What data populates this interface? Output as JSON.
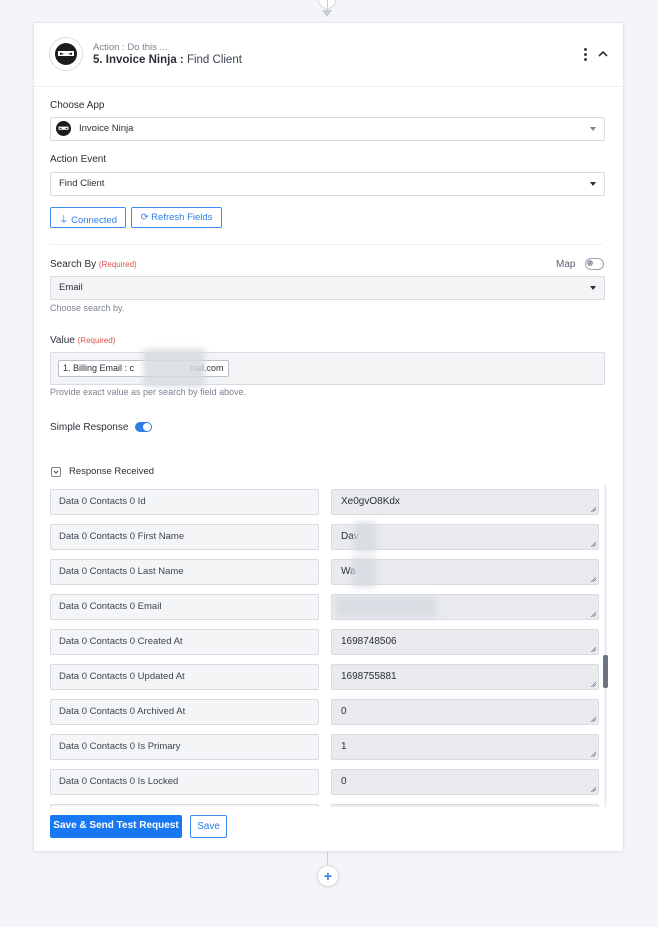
{
  "step": {
    "kicker": "Action : Do this ...",
    "title": "5. Invoice Ninja :",
    "subtitle": "Find Client"
  },
  "choose_app": {
    "label": "Choose App",
    "value": "Invoice Ninja"
  },
  "action_event": {
    "label": "Action Event",
    "value": "Find Client"
  },
  "buttons": {
    "connected": "Connected",
    "refresh": "Refresh Fields",
    "save_test": "Save & Send Test Request",
    "save": "Save"
  },
  "search_by": {
    "label": "Search By",
    "required": "(Required)",
    "map_label": "Map",
    "value": "Email",
    "hint": "Choose search by."
  },
  "value_field": {
    "label": "Value",
    "required": "(Required)",
    "chip_prefix": "1. Billing Email : c",
    "chip_suffix": "nail.com",
    "hint": "Provide exact value as per search by field above."
  },
  "simple_response": {
    "label": "Simple Response",
    "enabled": true
  },
  "response_received": {
    "label": "Response Received",
    "rows": [
      {
        "key": "Data 0 Contacts 0 Id",
        "value": "Xe0gvO8Kdx"
      },
      {
        "key": "Data 0 Contacts 0 First Name",
        "value": "Dav"
      },
      {
        "key": "Data 0 Contacts 0 Last Name",
        "value": "Wa"
      },
      {
        "key": "Data 0 Contacts 0 Email",
        "value": ""
      },
      {
        "key": "Data 0 Contacts 0 Created At",
        "value": "1698748506"
      },
      {
        "key": "Data 0 Contacts 0 Updated At",
        "value": "1698755881"
      },
      {
        "key": "Data 0 Contacts 0 Archived At",
        "value": "0"
      },
      {
        "key": "Data 0 Contacts 0 Is Primary",
        "value": "1"
      },
      {
        "key": "Data 0 Contacts 0 Is Locked",
        "value": "0"
      },
      {
        "key": "",
        "value": ""
      }
    ]
  },
  "colors": {
    "accent": "#1877f2",
    "required": "#e0534b"
  }
}
